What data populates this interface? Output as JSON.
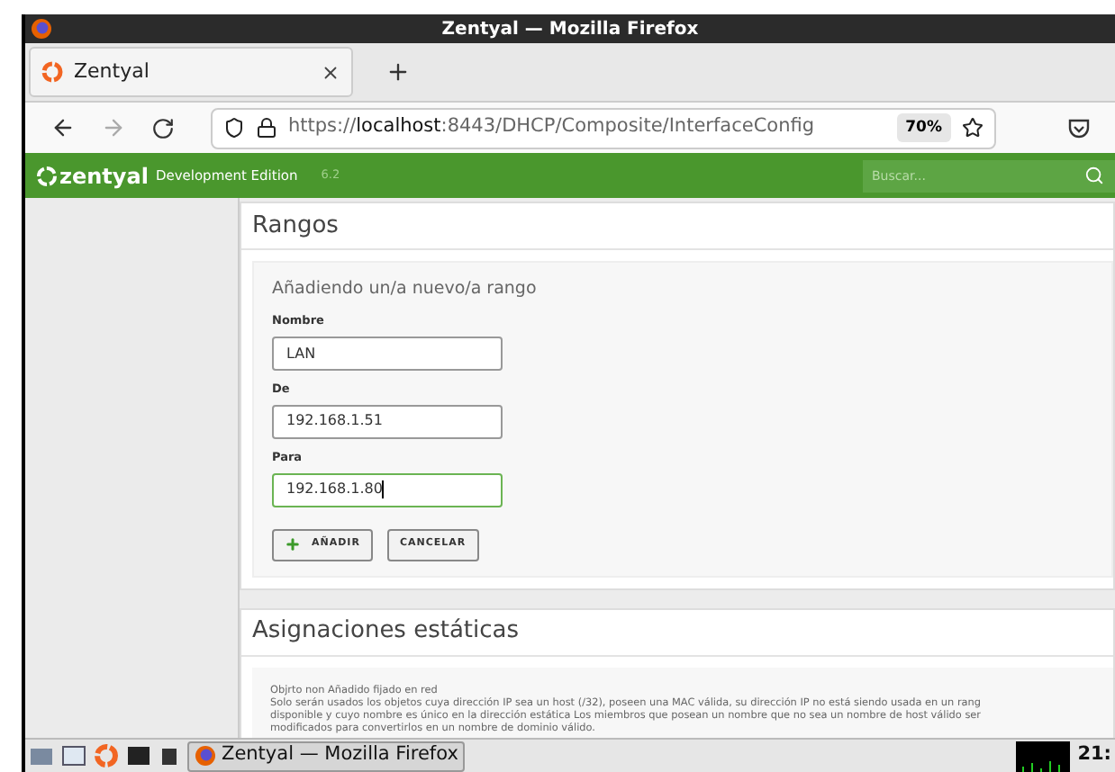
{
  "window": {
    "title": "Zentyal — Mozilla Firefox"
  },
  "tabs": [
    {
      "label": "Zentyal",
      "selected": true
    }
  ],
  "address_bar": {
    "scheme": "https://",
    "host": "localhost",
    "path": ":8443/DHCP/Composite/InterfaceConfig",
    "zoom": "70%"
  },
  "header": {
    "brand": "zentyal",
    "edition": "Development Edition",
    "version": "6.2",
    "search": {
      "placeholder": "Buscar..."
    }
  },
  "ranges_panel": {
    "title": "Rangos",
    "form_title": "Añadiendo un/a nuevo/a rango",
    "fields": [
      {
        "label": "Nombre",
        "value": "LAN",
        "focused": false
      },
      {
        "label": "De",
        "value": "192.168.1.51",
        "focused": false
      },
      {
        "label": "Para",
        "value": "192.168.1.80",
        "focused": true
      }
    ],
    "buttons": [
      {
        "kind": "add",
        "label": "AÑADIR"
      },
      {
        "kind": "cancel",
        "label": "CANCELAR"
      }
    ]
  },
  "static_panel": {
    "title": "Asignaciones estáticas",
    "note_lines": [
      "Objrto non Añadido fijado en red",
      "Solo serán usados los objetos cuya dirección IP sea un host (/32), poseen una MAC válida, su dirección IP no está siendo usada en un rang",
      "disponible y cuyo nombre es único en la dirección estática Los miembros que posean un nombre que no sea un nombre de host válido ser",
      "modificados para convertirlos en un nombre de dominio válido."
    ]
  },
  "taskbar": {
    "task": "Zentyal — Mozilla Firefox",
    "clock": "21:"
  }
}
